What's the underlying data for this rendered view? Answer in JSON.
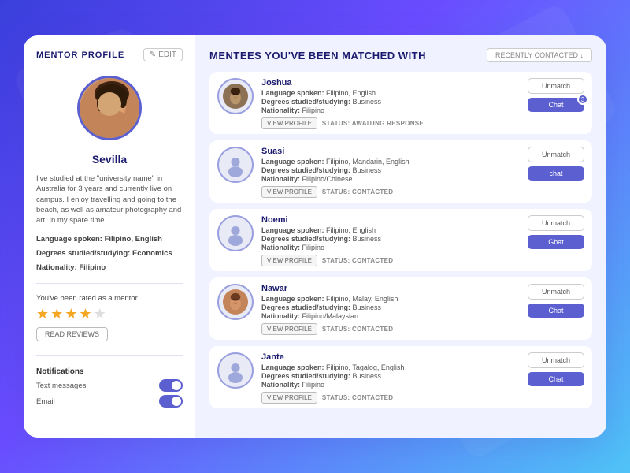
{
  "background": {
    "gradient": "linear-gradient(135deg, #3a3fdb 0%, #6a4cff 40%, #4fc3f7 100%)"
  },
  "card": {
    "left": {
      "header": {
        "title": "MENTOR PROFILE",
        "edit_label": "EDIT"
      },
      "mentor": {
        "name": "Sevilla",
        "bio": "I've studied at the \"university name\" in Australia for 3 years and currently live on campus. I enjoy travelling and going to the beach, as well as amateur photography and art. In my spare time.",
        "language_label": "Language spoken:",
        "language_value": "Filipino, English",
        "degrees_label": "Degrees studied/studying:",
        "degrees_value": "Economics",
        "nationality_label": "Nationality:",
        "nationality_value": "Filipino"
      },
      "rating": {
        "label": "You've been rated as a mentor",
        "stars": [
          true,
          true,
          true,
          true,
          false
        ],
        "read_reviews_label": "READ REVIEWS"
      },
      "notifications": {
        "title": "Notifications",
        "text_messages_label": "Text messages",
        "text_messages_on": true,
        "email_label": "Email",
        "email_on": true
      }
    },
    "right": {
      "title": "MENTEES YOU'VE BEEN MATCHED WITH",
      "recently_btn_label": "RECENTLY CONTACTED ↓",
      "mentees": [
        {
          "name": "Joshua",
          "has_photo": true,
          "photo_class": "mentee-photo-joshua",
          "language_spoken": "Filipino, English",
          "degrees": "Business",
          "nationality": "Filipino",
          "view_profile_label": "VIEW PROFILE",
          "status_label": "STATUS: AWAITING RESPONSE",
          "unmatch_label": "Unmatch",
          "chat_label": "Chat",
          "chat_badge": 3
        },
        {
          "name": "Suasi",
          "has_photo": false,
          "photo_class": "",
          "language_spoken": "Filipino, Mandarin, English",
          "degrees": "Business",
          "nationality": "Filipino/Chinese",
          "view_profile_label": "VIEW PROFILE",
          "status_label": "STATUS: CONTACTED",
          "unmatch_label": "Unmatch",
          "chat_label": "chat",
          "chat_badge": null
        },
        {
          "name": "Noemi",
          "has_photo": false,
          "photo_class": "",
          "language_spoken": "Filipino, English",
          "degrees": "Business",
          "nationality": "Filipino",
          "view_profile_label": "VIEW PROFILE",
          "status_label": "STATUS: CONTACTED",
          "unmatch_label": "Unmatch",
          "chat_label": "Ghat",
          "chat_badge": null
        },
        {
          "name": "Nawar",
          "has_photo": true,
          "photo_class": "mentee-photo-nawar",
          "language_spoken": "Filipino, Malay, English",
          "degrees": "Business",
          "nationality": "Filipino/Malaysian",
          "view_profile_label": "VIEW PROFILE",
          "status_label": "STATUS: CONTACTED",
          "unmatch_label": "Unmatch",
          "chat_label": "Chat",
          "chat_badge": null
        },
        {
          "name": "Jante",
          "has_photo": false,
          "photo_class": "",
          "language_spoken": "Filipino, Tagalog, English",
          "degrees": "Business",
          "nationality": "Filipino",
          "view_profile_label": "VIEW PROFILE",
          "status_label": "STATUS: CONTACTED",
          "unmatch_label": "Unmatch",
          "chat_label": "Chat",
          "chat_badge": null
        }
      ]
    }
  }
}
